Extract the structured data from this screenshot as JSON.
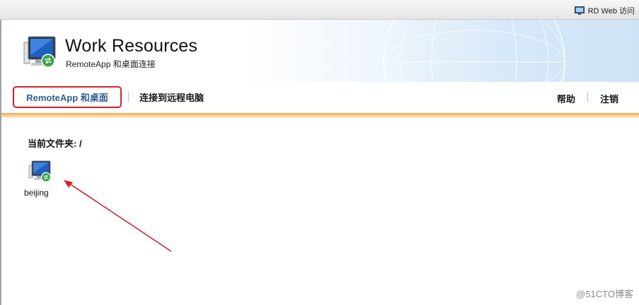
{
  "top_bar": {
    "label": "RD Web 访问"
  },
  "header": {
    "title": "Work Resources",
    "subtitle": "RemoteApp 和桌面连接"
  },
  "nav": {
    "tabs": [
      {
        "label": "RemoteApp 和桌面"
      },
      {
        "label": "连接到远程电脑"
      }
    ],
    "help": "帮助",
    "logout": "注销"
  },
  "content": {
    "folder_label": "当前文件夹: /",
    "items": [
      {
        "label": "beijing",
        "icon": "remote-desktop-icon"
      }
    ]
  },
  "annotation": {
    "color": "#d2232a"
  },
  "watermark": "@51CTO博客"
}
